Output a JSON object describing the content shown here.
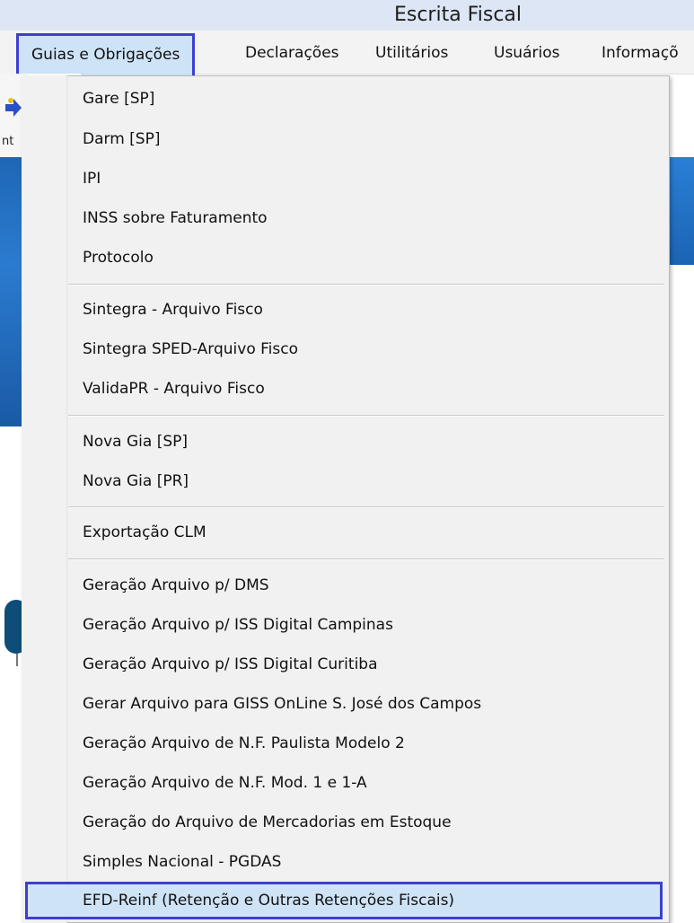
{
  "window": {
    "title": "Escrita Fiscal"
  },
  "menubar": {
    "items": [
      {
        "label": "Guias e Obrigações",
        "active": true
      },
      {
        "label": "Declarações"
      },
      {
        "label": "Utilitários"
      },
      {
        "label": "Usuários"
      },
      {
        "label": "Informaçõ"
      }
    ]
  },
  "background": {
    "toolbar_label": "nt"
  },
  "dropdown": {
    "items": [
      "Gare  [SP]",
      "Darm  [SP]",
      "IPI",
      "INSS sobre Faturamento",
      "Protocolo",
      "Sintegra  - Arquivo Fisco",
      "Sintegra SPED-Arquivo Fisco",
      "ValidaPR - Arquivo Fisco",
      "Nova Gia  [SP]",
      "Nova Gia [PR]",
      "Exportação CLM",
      "Geração Arquivo p/ DMS",
      "Geração Arquivo p/ ISS Digital Campinas",
      "Geração Arquivo p/ ISS Digital Curitiba",
      "Gerar Arquivo para GISS OnLine S. José dos Campos",
      "Geração Arquivo de N.F. Paulista Modelo 2",
      "Geração Arquivo de N.F. Mod. 1 e 1-A",
      "Geração do Arquivo de Mercadorias em Estoque",
      "Simples Nacional - PGDAS",
      "EFD-Reinf (Retenção e Outras Retenções Fiscais)"
    ],
    "highlighted_item": "EFD-Reinf (Retenção e Outras Retenções Fiscais)"
  },
  "colors": {
    "highlight_border": "#3d3fd0",
    "highlight_fill": "#cfe3f7",
    "menu_background": "#f1f1f1"
  }
}
